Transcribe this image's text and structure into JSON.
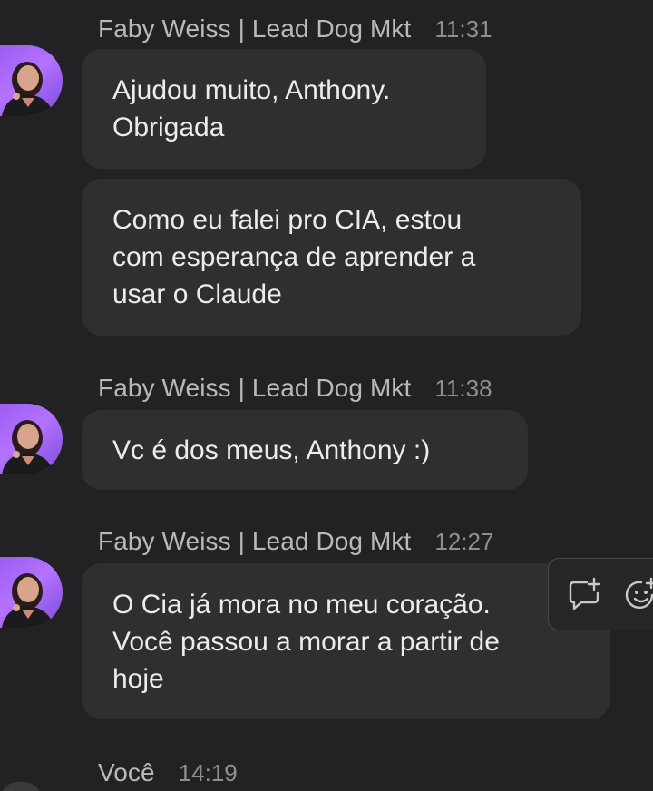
{
  "messages": [
    {
      "sender": "Faby Weiss | Lead Dog Mkt",
      "time": "11:31",
      "bubbles": [
        "Ajudou muito, Anthony.\nObrigada",
        "Como eu falei pro CIA, estou\ncom esperança de aprender a\nusar o Claude"
      ]
    },
    {
      "sender": "Faby Weiss | Lead Dog Mkt",
      "time": "11:38",
      "bubbles": [
        "Vc é  dos meus, Anthony :)"
      ]
    },
    {
      "sender": "Faby Weiss | Lead Dog Mkt",
      "time": "12:27",
      "bubbles": [
        "O Cia já mora no meu coração.\nVocê passou a morar a partir de\nhoje"
      ]
    },
    {
      "sender": "Você",
      "time": "14:19"
    }
  ],
  "hover_actions": {
    "icons": [
      "reply-thread-icon",
      "add-reaction-icon"
    ]
  },
  "colors": {
    "background": "#222224",
    "bubble": "#2f2f31",
    "text": "#ececee",
    "sender": "#b9b9bc",
    "time": "#8f8f93",
    "avatar_accent": "#b472ff"
  }
}
